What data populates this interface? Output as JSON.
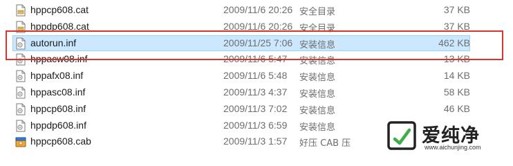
{
  "files": [
    {
      "name": "hppcp608.cat",
      "date": "2009/11/6 20:26",
      "type": "安全目录",
      "size": "37 KB",
      "icon": "catalog-file-icon"
    },
    {
      "name": "hppdp608.cat",
      "date": "2009/11/6 20:26",
      "type": "安全目录",
      "size": "37 KB",
      "icon": "catalog-file-icon"
    },
    {
      "name": "autorun.inf",
      "date": "2009/11/25 7:06",
      "type": "安装信息",
      "size": "462 KB",
      "icon": "setup-info-file-icon",
      "selected": true
    },
    {
      "name": "hppacw08.inf",
      "date": "2009/11/6 5:47",
      "type": "安装信息",
      "size": "13 KB",
      "icon": "setup-info-file-icon"
    },
    {
      "name": "hppafx08.inf",
      "date": "2009/11/6 5:48",
      "type": "安装信息",
      "size": "14 KB",
      "icon": "setup-info-file-icon"
    },
    {
      "name": "hppasc08.inf",
      "date": "2009/11/3 4:37",
      "type": "安装信息",
      "size": "58 KB",
      "icon": "setup-info-file-icon"
    },
    {
      "name": "hppcp608.inf",
      "date": "2009/11/3 7:02",
      "type": "安装信息",
      "size": "46 KB",
      "icon": "setup-info-file-icon"
    },
    {
      "name": "hppdp608.inf",
      "date": "2009/11/3 6:59",
      "type": "安装信息",
      "size": "",
      "icon": "setup-info-file-icon"
    },
    {
      "name": "hppcp608.cab",
      "date": "2009/11/3 1:57",
      "type": "好压 CAB 压",
      "size": "",
      "icon": "cab-archive-icon"
    }
  ],
  "watermark": {
    "brand": "爱纯净",
    "url": "www.aichunjing.com"
  },
  "colors": {
    "selection_fill": "#cce8ff",
    "selection_border": "#99d1ff",
    "annotation_red": "#d9342b"
  }
}
